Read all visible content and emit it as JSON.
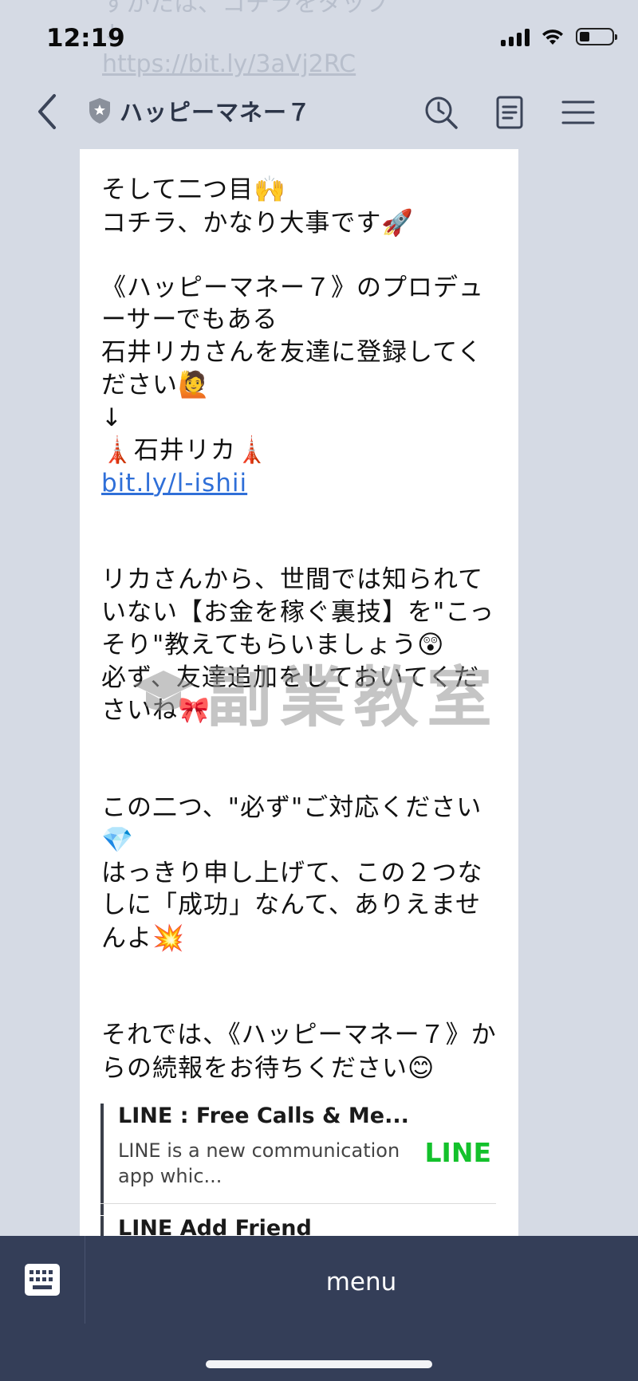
{
  "status_bar": {
    "time": "12:19"
  },
  "ghost_message": {
    "line1": "すかたは、コチラをタップ",
    "arrow": "↓",
    "link": "https://bit.ly/3aVj2RC"
  },
  "header": {
    "title": "ハッピーマネー７"
  },
  "message": {
    "p1_l1": "そして二つ目",
    "p1_l2": "コチラ、かなり大事です",
    "p2": "《ハッピーマネー７》のプロデューサーでもある\n石井リカさんを友達に登録してください",
    "arrow": "↓",
    "name": "石井リカ",
    "link": "bit.ly/l-ishii",
    "p3": "リカさんから、世間では知られていない【お金を稼ぐ裏技】を\"こっそり\"教えてもらいましょう",
    "p3b": "必ず、友達追加をしておいてくださいね",
    "p4": "この二つ、\"必ず\"ご対応ください",
    "p4b": "はっきり申し上げて、この２つなしに「成功」なんて、ありえませんよ",
    "p5": "それでは、《ハッピーマネー７》からの続報をお待ちください",
    "emoji": {
      "raised_hands": "🙌",
      "rocket": "🚀",
      "person_raising_hand": "🙋",
      "tower": "🗼",
      "astonished": "😲",
      "ribbon": "🎀",
      "gem": "💎",
      "collision": "💥",
      "smile": "😊"
    }
  },
  "link_cards": [
    {
      "title": "LINE : Free Calls & Me...",
      "desc": "LINE is a new communication app whic...",
      "brand": "LINE"
    },
    {
      "title": "LINE Add Friend"
    }
  ],
  "watermark": {
    "text": "副業教室"
  },
  "bottom_bar": {
    "menu_label": "menu"
  },
  "colors": {
    "background": "#d5dae4",
    "bottom_bar": "#343e58",
    "link": "#2f6fd8",
    "line_green": "#13c12b"
  }
}
